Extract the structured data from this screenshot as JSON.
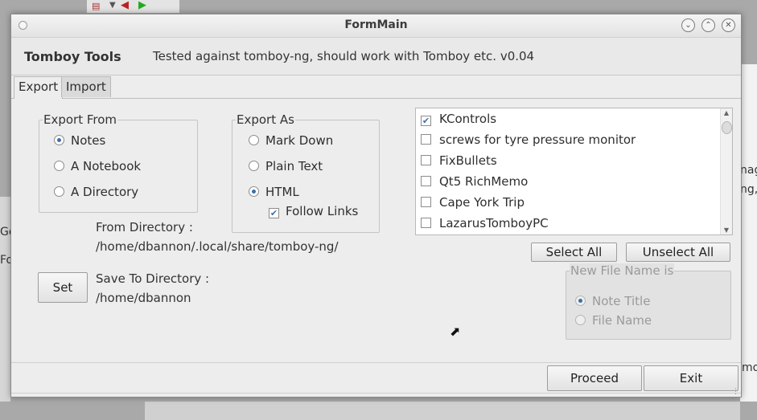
{
  "window": {
    "title": "FormMain"
  },
  "header": {
    "app_name": "Tomboy Tools",
    "description": "Tested against tomboy-ng, should work with Tomboy etc. v0.04"
  },
  "tabs": [
    {
      "label": "Export",
      "active": true
    },
    {
      "label": "Import",
      "active": false
    }
  ],
  "export_from": {
    "label": "Export From",
    "options": [
      {
        "label": "Notes",
        "selected": true
      },
      {
        "label": "A Notebook",
        "selected": false
      },
      {
        "label": "A Directory",
        "selected": false
      }
    ]
  },
  "export_as": {
    "label": "Export As",
    "options": [
      {
        "label": "Mark Down",
        "selected": false
      },
      {
        "label": "Plain Text",
        "selected": false
      },
      {
        "label": "HTML",
        "selected": true
      }
    ],
    "follow_links": {
      "label": "Follow Links",
      "checked": true
    }
  },
  "from_directory": {
    "label": "From Directory :",
    "path": "/home/dbannon/.local/share/tomboy-ng/"
  },
  "save_to": {
    "set_label": "Set",
    "label": "Save To Directory :",
    "path": "/home/dbannon"
  },
  "notes_list": [
    {
      "label": "KControls",
      "checked": true
    },
    {
      "label": "screws for tyre pressure monitor",
      "checked": false
    },
    {
      "label": "FixBullets",
      "checked": false
    },
    {
      "label": "Qt5 RichMemo",
      "checked": false
    },
    {
      "label": "Cape York Trip",
      "checked": false
    },
    {
      "label": "LazarusTomboyPC",
      "checked": false
    }
  ],
  "select_all_label": "Select All",
  "unselect_all_label": "Unselect All",
  "new_file_name": {
    "label": "New File Name is",
    "options": [
      {
        "label": "Note Title",
        "selected": true
      },
      {
        "label": "File Name",
        "selected": false
      }
    ]
  },
  "proceed_label": "Proceed",
  "exit_label": "Exit",
  "background": {
    "right_text_1": "nag",
    "right_text_2": "ng,",
    "left_text_1": "Go",
    "left_text_2": "Fo",
    "right_text_3": "mo"
  }
}
